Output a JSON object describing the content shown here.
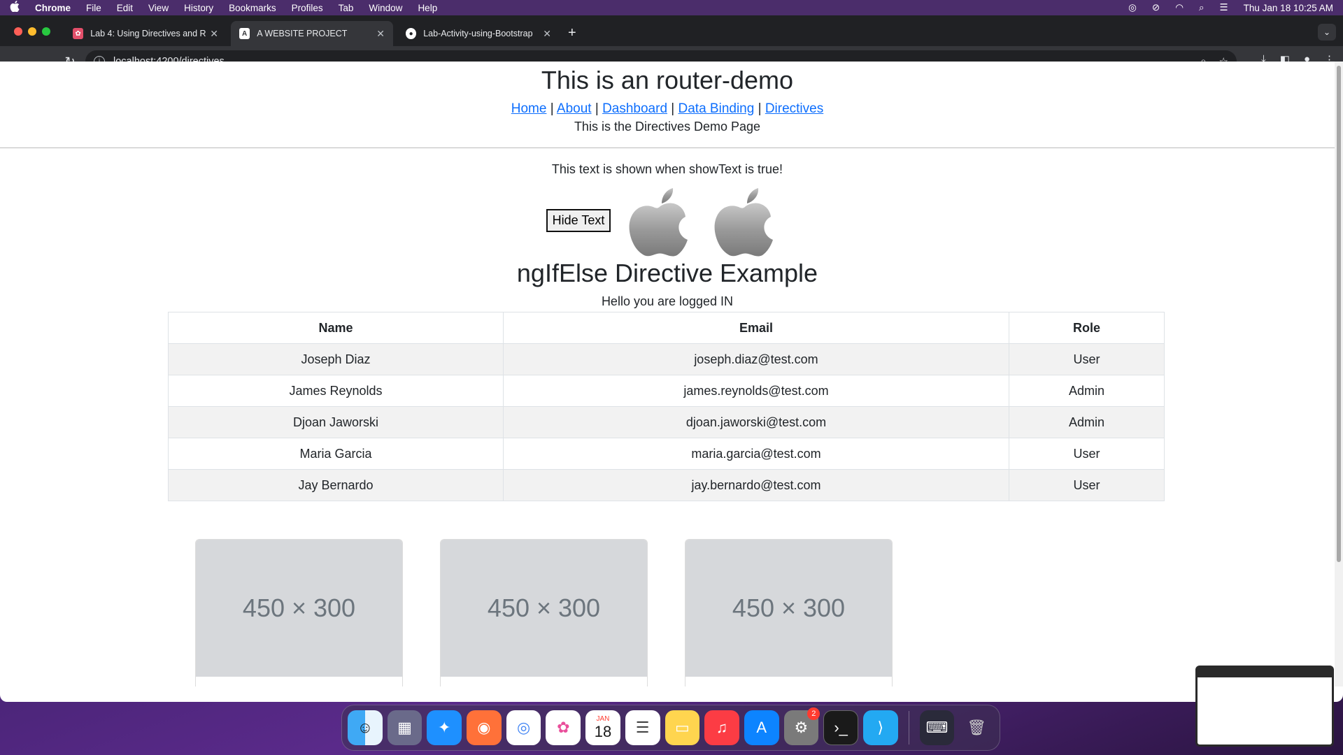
{
  "menubar": {
    "app": "Chrome",
    "items": [
      "File",
      "Edit",
      "View",
      "History",
      "Bookmarks",
      "Profiles",
      "Tab",
      "Window",
      "Help"
    ],
    "clock": "Thu Jan 18  10:25 AM"
  },
  "tabs": [
    {
      "title": "Lab 4: Using Directives and R",
      "favicon": "colorful-icon"
    },
    {
      "title": "A WEBSITE PROJECT",
      "favicon": "angular-icon"
    },
    {
      "title": "Lab-Activity-using-Bootstrap",
      "favicon": "github-icon"
    }
  ],
  "address": {
    "url": "localhost:4200/directives"
  },
  "page": {
    "title": "This is an router-demo",
    "nav": {
      "home": "Home",
      "sep1": "|",
      "about": "About",
      "sep2": "|",
      "dashboard": "Dashboard",
      "sep3": "|",
      "data_binding": "Data Binding",
      "sep4": "|",
      "directives": "Directives"
    },
    "subtitle": "This is the Directives Demo Page",
    "show_text": "This text is shown when showText is true!",
    "hide_button": "Hide Text",
    "heading2": "ngIfElse Directive Example",
    "logged_in": "Hello you are logged IN",
    "table": {
      "headers": [
        "Name",
        "Email",
        "Role"
      ],
      "rows": [
        [
          "Joseph Diaz",
          "joseph.diaz@test.com",
          "User"
        ],
        [
          "James Reynolds",
          "james.reynolds@test.com",
          "Admin"
        ],
        [
          "Djoan Jaworski",
          "djoan.jaworski@test.com",
          "Admin"
        ],
        [
          "Maria Garcia",
          "maria.garcia@test.com",
          "User"
        ],
        [
          "Jay Bernardo",
          "jay.bernardo@test.com",
          "User"
        ]
      ]
    },
    "placeholders": [
      "450 × 300",
      "450 × 300",
      "450 × 300"
    ]
  },
  "dock": {
    "calendar_month": "JAN",
    "calendar_day": "18",
    "settings_badge": "2"
  },
  "colors": {
    "link": "#0d6efd",
    "menubar": "#4b2d6b",
    "tabstrip": "#202124"
  }
}
